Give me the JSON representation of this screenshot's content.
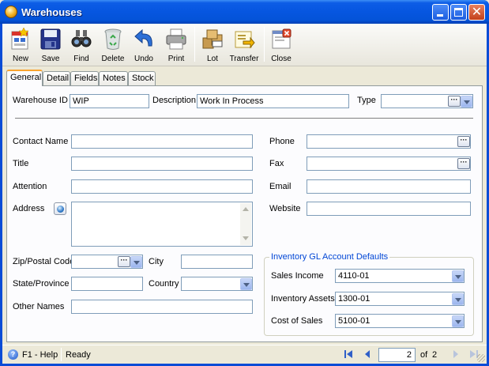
{
  "window": {
    "title": "Warehouses"
  },
  "toolbar": {
    "new": "New",
    "save": "Save",
    "find": "Find",
    "delete": "Delete",
    "undo": "Undo",
    "print": "Print",
    "lot": "Lot",
    "transfer": "Transfer",
    "close": "Close"
  },
  "tabs": [
    "General",
    "Detail",
    "Fields",
    "Notes",
    "Stock"
  ],
  "form": {
    "warehouse_id_label": "Warehouse ID",
    "warehouse_id_value": "WIP",
    "description_label": "Description",
    "description_value": "Work In Process",
    "type_label": "Type",
    "type_value": "",
    "contact_name_label": "Contact Name",
    "title_label": "Title",
    "attention_label": "Attention",
    "address_label": "Address",
    "zip_label": "Zip/Postal Code",
    "city_label": "City",
    "state_label": "State/Province",
    "country_label": "Country",
    "other_names_label": "Other Names",
    "phone_label": "Phone",
    "fax_label": "Fax",
    "email_label": "Email",
    "website_label": "Website"
  },
  "gl_defaults": {
    "title": "Inventory GL Account Defaults",
    "sales_income_label": "Sales Income",
    "sales_income_value": "4110-01",
    "inventory_assets_label": "Inventory Assets",
    "inventory_assets_value": "1300-01",
    "cost_of_sales_label": "Cost of Sales",
    "cost_of_sales_value": "5100-01"
  },
  "status": {
    "help": "F1 - Help",
    "state": "Ready",
    "page_current": "2",
    "of_label": "of",
    "page_total": "2"
  },
  "colors": {
    "titlebar": "#0656e0",
    "group_title": "#0046d5",
    "tab_accent": "#f9a42f"
  }
}
